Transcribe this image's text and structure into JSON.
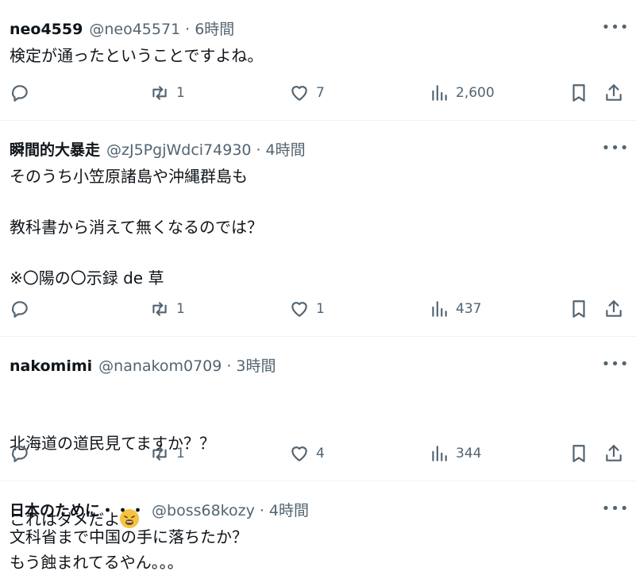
{
  "tweets": [
    {
      "name": "neo4559",
      "handle": "@neo45571",
      "time": "6時間",
      "text": "検定が通ったということですよね。",
      "replies": "",
      "retweets": "1",
      "likes": "7",
      "views": "2,600"
    },
    {
      "name": "瞬間的大暴走",
      "handle": "@zJ5PgjWdci74930",
      "time": "4時間",
      "text": "そのうち小笠原諸島や沖縄群島も\n\n教科書から消えて無くなるのでは？\n\n※〇陽の〇示録 de 草",
      "replies": "",
      "retweets": "1",
      "likes": "1",
      "views": "437"
    },
    {
      "name": "nakomimi",
      "handle": "@nanakom0709",
      "time": "3時間",
      "text_line1": "北海道の道民見てますか？？",
      "text_line2": "これはダメだよ",
      "emoji": "weary-face",
      "replies": "",
      "retweets": "1",
      "likes": "4",
      "views": "344"
    },
    {
      "name": "日本のために・・・",
      "handle": "@boss68kozy",
      "time": "4時間",
      "text": "文科省まで中国の手に落ちたか？\nもう蝕まれてるやん。。。"
    }
  ],
  "separator": "·",
  "more_glyph": "•••"
}
